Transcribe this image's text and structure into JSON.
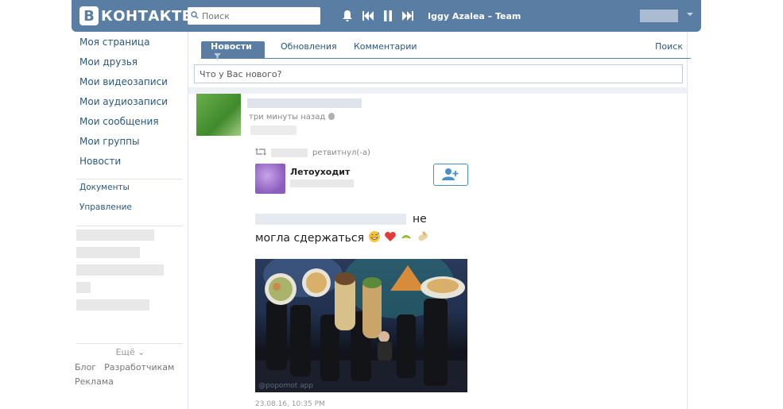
{
  "header": {
    "logo_letter": "B",
    "logo_text": "КОНТАКТЕ",
    "search_placeholder": "Поиск",
    "track": "Iggy Azalea – Team"
  },
  "sidebar": {
    "items": [
      {
        "label": "Моя страница"
      },
      {
        "label": "Мои друзья"
      },
      {
        "label": "Мои видеозаписи"
      },
      {
        "label": "Мои аудиозаписи"
      },
      {
        "label": "Мои сообщения"
      },
      {
        "label": "Мои группы"
      },
      {
        "label": "Новости"
      }
    ],
    "small_items": [
      {
        "label": "Документы"
      },
      {
        "label": "Управление"
      }
    ],
    "more_label": "Ещё",
    "footer_links": [
      "Блог",
      "Разработчикам",
      "Реклама"
    ]
  },
  "tabs": {
    "items": [
      {
        "label": "Новости",
        "active": true
      },
      {
        "label": "Обновления",
        "active": false
      },
      {
        "label": "Комментарии",
        "active": false
      }
    ],
    "search_label": "Поиск"
  },
  "composer": {
    "placeholder": "Что у Вас нового?"
  },
  "post": {
    "time": "три минуты назад",
    "repost_suffix": "ретвитнул(-а)",
    "group_name": "Летоуходит",
    "text_tail": "не",
    "text_line2": "могла сдержаться",
    "date": "23.08.16, 10:35 PM",
    "watermark": "@popomot app"
  },
  "colors": {
    "brand": "#597da3",
    "link": "#2b587a"
  }
}
